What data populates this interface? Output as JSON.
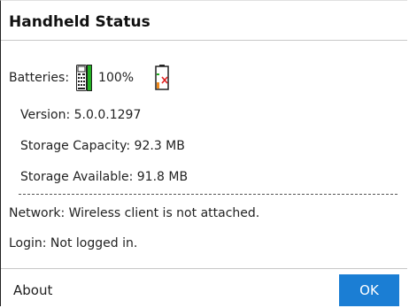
{
  "dialog": {
    "title": "Handheld Status"
  },
  "batteries": {
    "label": "Batteries:",
    "handheld_percent": "100%",
    "handheld_icon": "calculator-battery-full-icon",
    "spare_icon": "spare-battery-missing-icon"
  },
  "info": {
    "version": "Version: 5.0.0.1297",
    "storage_capacity": "Storage Capacity: 92.3 MB",
    "storage_available": "Storage Available: 91.8 MB",
    "network": "Network: Wireless client is not attached.",
    "login": "Login: Not logged in."
  },
  "footer": {
    "about_label": "About",
    "ok_label": "OK"
  },
  "colors": {
    "accent": "#1b7ed4",
    "battery_green": "#22b122",
    "battery_orange": "#f08a1c",
    "battery_red": "#e02020"
  }
}
